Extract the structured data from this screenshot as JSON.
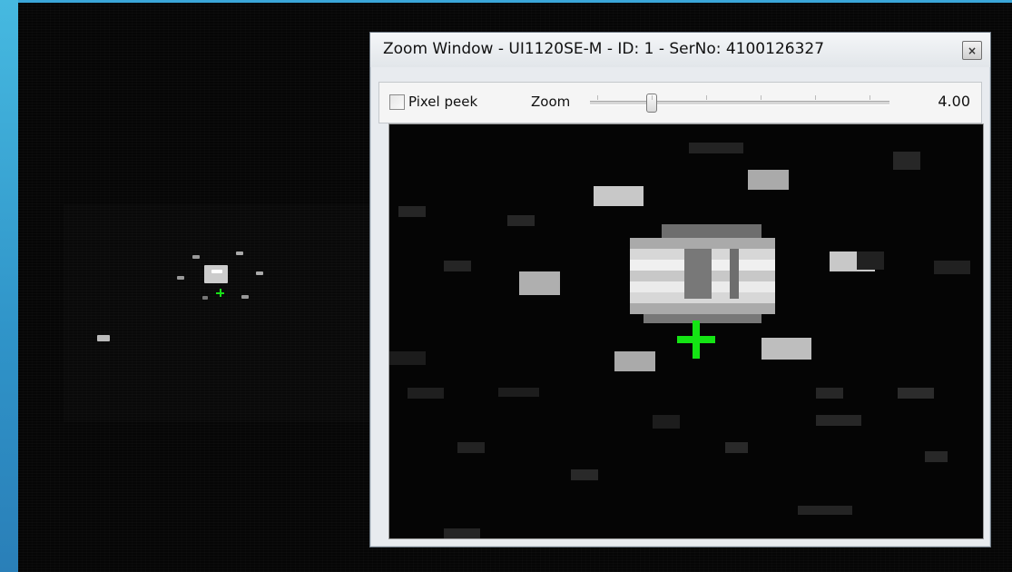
{
  "zoom_window": {
    "title": "Zoom Window - UI1120SE-M - ID: 1 - SerNo: 4100126327",
    "close_glyph": "×",
    "pixel_peek": {
      "label": "Pixel peek",
      "checked": false
    },
    "zoom": {
      "label": "Zoom",
      "value": "4.00"
    }
  },
  "colors": {
    "accent_crosshair": "#18e018",
    "window_bg": "#e8ebef",
    "desktop_blue": "#3aa6d8"
  },
  "icons": [
    "close-icon",
    "crosshair-icon"
  ]
}
